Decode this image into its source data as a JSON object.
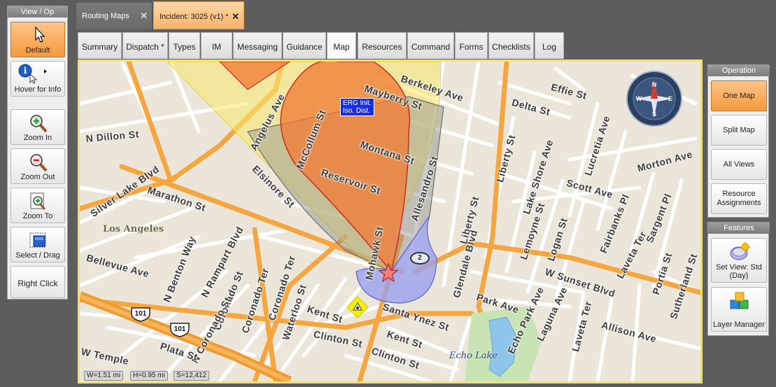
{
  "left_panel": {
    "header": "View / Op",
    "tools": [
      {
        "label": "Default",
        "icon": "cursor-arrow-icon",
        "active": true
      },
      {
        "label": "Hover for Info",
        "icon": "info-hover-icon"
      },
      {
        "label": "Zoom In",
        "icon": "zoom-in-icon"
      },
      {
        "label": "Zoom Out",
        "icon": "zoom-out-icon"
      },
      {
        "label": "Zoom To",
        "icon": "zoom-to-icon"
      },
      {
        "label": "Select / Drag",
        "icon": "select-drag-icon"
      },
      {
        "label": "Right Click"
      }
    ]
  },
  "top_tabs": [
    {
      "label": "Routing Maps",
      "close": "✕"
    },
    {
      "label": "Incident: 3025 (v1) *",
      "close": "✕",
      "active": true
    }
  ],
  "sub_tabs": [
    {
      "label": "Summary"
    },
    {
      "label": "Dispatch *"
    },
    {
      "label": "Types"
    },
    {
      "label": "IM"
    },
    {
      "label": "Messaging"
    },
    {
      "label": "Guidance"
    },
    {
      "label": "Map",
      "active": true
    },
    {
      "label": "Resources"
    },
    {
      "label": "Command"
    },
    {
      "label": "Forms"
    },
    {
      "label": "Checklists"
    },
    {
      "label": "Log"
    }
  ],
  "map": {
    "erg_label_line1": "ERG Init.",
    "erg_label_line2": "Iso. Dist.",
    "marker_number": "2",
    "streets": {
      "berkeley": "Berkeley Ave",
      "mayberry": "Mayberry St",
      "effie": "Effie St",
      "delta": "Delta St",
      "dillon": "N Dillon St",
      "angelus": "Angelus Ave",
      "mccollum": "McCollum St",
      "elsinore": "Elsinore St",
      "montana": "Montana St",
      "reservoir": "Reservoir St",
      "allesandro": "Allesandro St",
      "silverlake": "Silver Lake Blvd",
      "marathon": "Marathon St",
      "lucretia": "Lucretia Ave",
      "morton": "Morton Ave",
      "liberty": "Liberty St",
      "lakeshore": "Lake Shore Ave",
      "scott": "Scott Ave",
      "fairbanks": "Fairbanks Pl",
      "sargent": "Sargent Pl",
      "mohawk": "Mohawk St",
      "liberty2": "Liberty St",
      "lemoyne": "Lemoyne St",
      "logan": "Logan St",
      "lavetaTer": "Laveta Ter",
      "portia": "Portia St",
      "nbenton": "N Benton Way",
      "nrampart": "N Rampart Blvd",
      "bellevue": "Bellevue Ave",
      "glendale": "Glendale Blvd",
      "wsunset": "W Sunset Blvd",
      "sutherland": "Sutherland St",
      "coronado1": "Coronado Ter",
      "coronado2": "Coronado St",
      "coronadoTer2": "Coronado Ter",
      "waterloo": "Waterloo St",
      "kent1": "Kent St",
      "santaynez": "Santa Ynez St",
      "parkave": "Park Ave",
      "echopark": "Echo Park Ave",
      "laguna": "Laguna Ave",
      "laveta2": "Laveta Ter",
      "allison": "Allison Ave",
      "ncoronado": "N Coronado St",
      "clinton1": "Clinton St",
      "clinton2": "Clinton St",
      "kent2": "Kent St",
      "plata": "Plata St",
      "wtemple": "W Temple"
    },
    "city": "Los Angeles",
    "lake": "Echo Lake",
    "shields": [
      "101",
      "101"
    ],
    "scale_w": "W=1.51 mi",
    "scale_h": "H=0.95 mi",
    "scale_s": "S=12,412",
    "colors": {
      "yellow_zone": "#f7ea6a",
      "gray_zone": "#8e8e8e",
      "orange_zone": "#f07a34",
      "blue_zone": "#9aa0ec",
      "major_road": "#f5a640"
    }
  },
  "right_panel": {
    "operation_header": "Operation",
    "operation_buttons": [
      {
        "label": "One Map",
        "active": true
      },
      {
        "label": "Split Map"
      },
      {
        "label": "All Views"
      },
      {
        "label": "Resource Assignments"
      }
    ],
    "features_header": "Features",
    "feature_buttons": [
      {
        "label": "Set View: Std (Day)",
        "icon": "set-view-icon"
      },
      {
        "label": "Layer Manager",
        "icon": "layer-manager-icon"
      }
    ]
  }
}
